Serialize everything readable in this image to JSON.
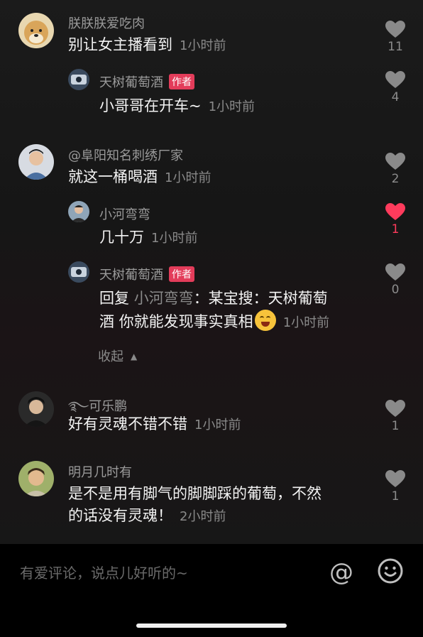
{
  "comments": [
    {
      "name": "朕朕朕爱吃肉",
      "text": "别让女主播看到",
      "time": "1小时前",
      "likes": "11"
    },
    {
      "name": "天树葡萄酒",
      "badge": "作者",
      "text": "小哥哥在开车~",
      "time": "1小时前",
      "likes": "4"
    },
    {
      "name": "@阜阳知名刺绣厂家",
      "text": "就这一桶喝酒",
      "time": "1小时前",
      "likes": "2"
    },
    {
      "name": "小河弯弯",
      "text": "几十万",
      "time": "1小时前",
      "likes": "1"
    },
    {
      "name": "天树葡萄酒",
      "badge": "作者",
      "reply_prefix": "回复 ",
      "reply_to": "小河弯弯",
      "text_line1": "：某宝搜：天树葡萄",
      "text_line2": "酒 你就能发现事实真相",
      "time": "1小时前",
      "likes": "0"
    },
    {
      "name": "࿐可乐鹏",
      "text": "好有灵魂不错不错",
      "time": "1小时前",
      "likes": "1"
    },
    {
      "name": "明月几时有",
      "text_line1": "是不是用有脚气的脚脚踩的葡萄，不然",
      "text_line2": "的话没有灵魂！",
      "time": "2小时前",
      "likes": "1"
    }
  ],
  "collapse_label": "收起",
  "input": {
    "placeholder": "有爱评论，说点儿好听的~"
  },
  "icons": {
    "like": "heart-icon",
    "at": "at-icon",
    "emoji": "emoji-icon"
  },
  "colors": {
    "liked": "#ff3b5c",
    "badge": "#e33c5a"
  }
}
